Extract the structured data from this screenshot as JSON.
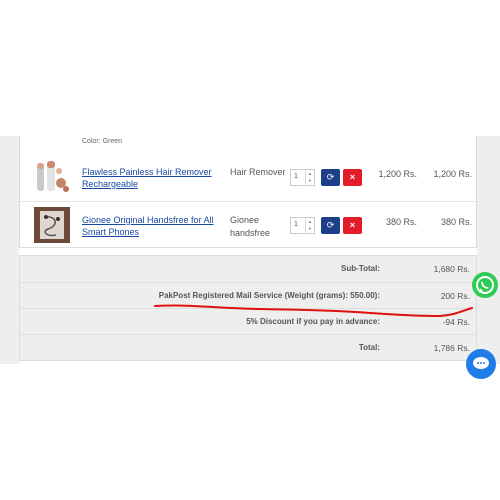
{
  "cart": {
    "color_note": "Color: Green",
    "items": [
      {
        "name": "Flawless Painless Hair Remover Rechargeable",
        "model": "Hair Remover",
        "quantity": "1",
        "unit_price": "1,200 Rs.",
        "total": "1,200 Rs."
      },
      {
        "name": "Gionee Original Handsfree for All Smart Phones",
        "model": "Gionee handsfree",
        "quantity": "1",
        "unit_price": "380 Rs.",
        "total": "380 Rs."
      }
    ]
  },
  "totals": [
    {
      "label": "Sub-Total:",
      "value": "1,680 Rs."
    },
    {
      "label": "PakPost Registered Mail Service (Weight (grams): 550.00):",
      "value": "200 Rs."
    },
    {
      "label": "5% Discount if you pay in advance:",
      "value": "-94 Rs."
    },
    {
      "label": "Total:",
      "value": "1,786 Rs."
    }
  ],
  "icons": {
    "update": "refresh-icon",
    "remove": "close-icon",
    "whatsapp": "whatsapp-icon",
    "chat": "chat-icon"
  },
  "colors": {
    "update_button": "#1c3f8a",
    "remove_button": "#e21d2a",
    "link": "#1a4aa0",
    "annotation": "#e01010",
    "whatsapp": "#2ecc55",
    "chat": "#1f7ce8"
  }
}
